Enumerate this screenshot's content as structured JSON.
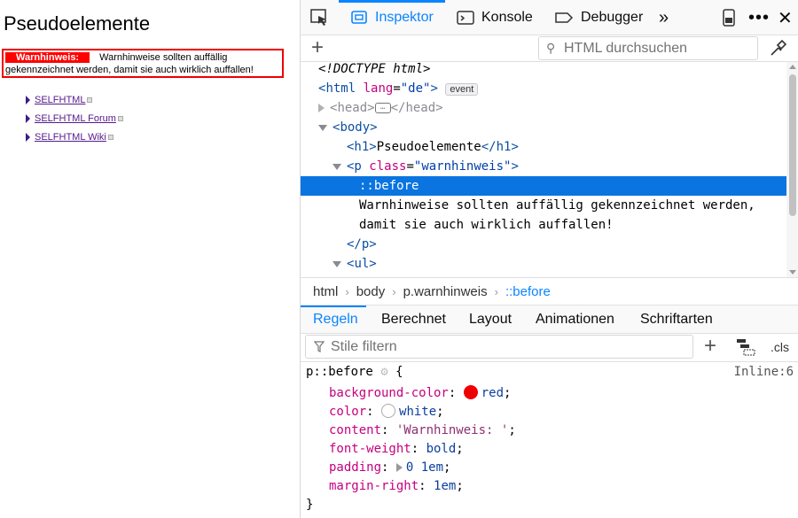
{
  "page": {
    "title": "Pseudoelemente",
    "warn_prefix": "Warnhinweis:",
    "warn_text": "Warnhinweise sollten auffällig gekennzeichnet werden, damit sie auch wirklich auffallen!",
    "links": [
      "SELFHTML",
      "SELFHTML Forum",
      "SELFHTML Wiki"
    ]
  },
  "devtools": {
    "tabs": {
      "inspector": "Inspektor",
      "console": "Konsole",
      "debugger": "Debugger"
    },
    "html_search_placeholder": "HTML durchsuchen",
    "markup": {
      "doctype": "<!DOCTYPE html>",
      "html_tag": "html",
      "html_attr": "lang",
      "html_val": "\"de\"",
      "event_badge": "event",
      "head": "head",
      "body": "body",
      "h1_text": "Pseudoelemente",
      "p_attr": "class",
      "p_val": "\"warnhinweis\"",
      "pseudo": "::before",
      "text_line1": "Warnhinweise sollten auffällig gekennzeichnet werden,",
      "text_line2": "damit sie auch wirklich auffallen!",
      "ul": "ul"
    },
    "breadcrumbs": [
      "html",
      "body",
      "p.warnhinweis",
      "::before"
    ],
    "rule_tabs": [
      "Regeln",
      "Berechnet",
      "Layout",
      "Animationen",
      "Schriftarten"
    ],
    "styles_filter_placeholder": "Stile filtern",
    "cls_label": ".cls",
    "rule": {
      "selector": "p::before",
      "source": "Inline:6",
      "declarations": [
        {
          "prop": "background-color",
          "value": "red",
          "swatch": "#ee0000"
        },
        {
          "prop": "color",
          "value": "white",
          "swatch": "#ffffff"
        },
        {
          "prop": "content",
          "value": "'Warnhinweis: '"
        },
        {
          "prop": "font-weight",
          "value": "bold"
        },
        {
          "prop": "padding",
          "value": "0 1em"
        },
        {
          "prop": "margin-right",
          "value": "1em"
        }
      ]
    }
  }
}
